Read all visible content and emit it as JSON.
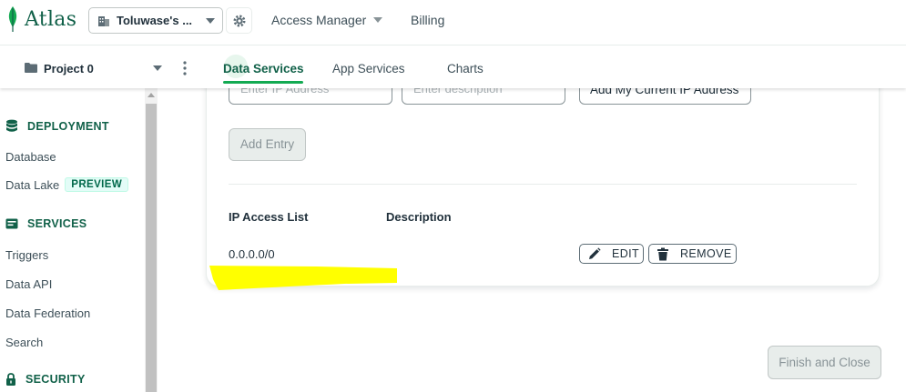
{
  "brand": {
    "name": "Atlas",
    "color": "#116149",
    "accent": "#13aa52"
  },
  "topbar": {
    "org_name": "Toluwase's ...",
    "links": [
      {
        "label": "Access Manager"
      },
      {
        "label": "Billing"
      }
    ]
  },
  "projectbar": {
    "project_name": "Project 0",
    "tabs": [
      {
        "label": "Data Services",
        "active": true
      },
      {
        "label": "App Services",
        "active": false
      },
      {
        "label": "Charts",
        "active": false
      }
    ]
  },
  "sidebar": {
    "sections": [
      {
        "title": "DEPLOYMENT",
        "icon": "deployment-icon",
        "items": [
          {
            "label": "Database"
          },
          {
            "label": "Data Lake",
            "badge": "PREVIEW"
          }
        ]
      },
      {
        "title": "SERVICES",
        "icon": "services-icon",
        "items": [
          {
            "label": "Triggers"
          },
          {
            "label": "Data API"
          },
          {
            "label": "Data Federation"
          },
          {
            "label": "Search"
          }
        ]
      },
      {
        "title": "SECURITY",
        "icon": "lock-icon",
        "items": []
      }
    ]
  },
  "form": {
    "ip_placeholder": "Enter IP Address",
    "description_placeholder": "Enter description",
    "add_current_ip_label": "Add My Current IP Address",
    "add_entry_label": "Add Entry"
  },
  "access_list": {
    "columns": [
      "IP Access List",
      "Description"
    ],
    "rows": [
      {
        "ip": "0.0.0.0/0",
        "description": ""
      }
    ],
    "edit_label": "EDIT",
    "remove_label": "REMOVE"
  },
  "footer": {
    "finish_label": "Finish and Close"
  },
  "highlight_color": "#ffff00"
}
